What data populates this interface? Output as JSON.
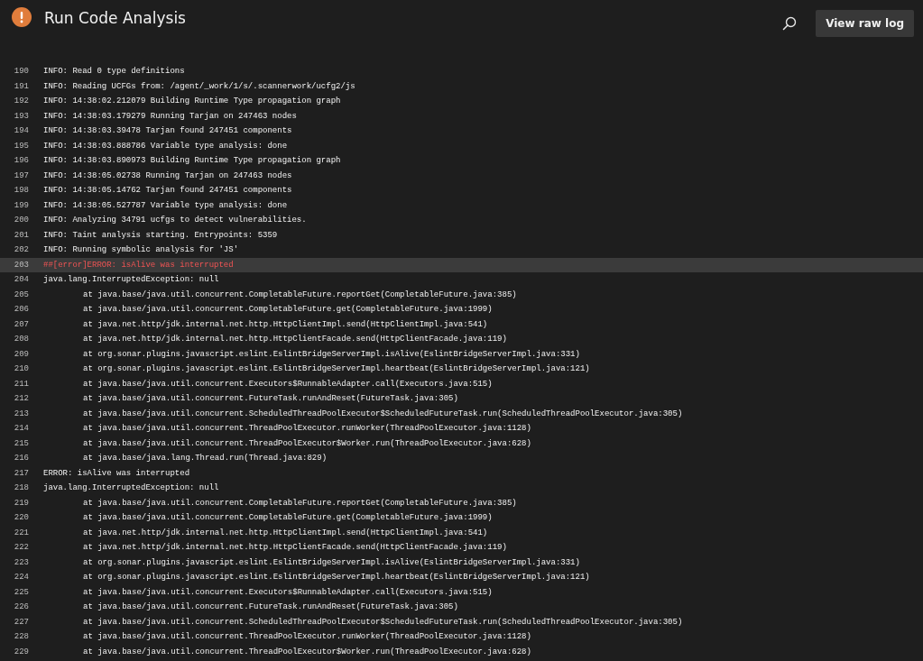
{
  "header": {
    "title": "Run Code Analysis",
    "button": "View raw log"
  },
  "log": [
    {
      "number": "190",
      "text": "INFO: Read 0 type definitions",
      "kind": "info",
      "indented": false,
      "selected": false
    },
    {
      "number": "191",
      "text": "INFO: Reading UCFGs from: /agent/_work/1/s/.scannerwork/ucfg2/js",
      "kind": "info",
      "indented": false,
      "selected": false
    },
    {
      "number": "192",
      "text": "INFO: 14:38:02.212079 Building Runtime Type propagation graph",
      "kind": "info",
      "indented": false,
      "selected": false
    },
    {
      "number": "193",
      "text": "INFO: 14:38:03.179279 Running Tarjan on 247463 nodes",
      "kind": "info",
      "indented": false,
      "selected": false
    },
    {
      "number": "194",
      "text": "INFO: 14:38:03.39478 Tarjan found 247451 components",
      "kind": "info",
      "indented": false,
      "selected": false
    },
    {
      "number": "195",
      "text": "INFO: 14:38:03.888786 Variable type analysis: done",
      "kind": "info",
      "indented": false,
      "selected": false
    },
    {
      "number": "196",
      "text": "INFO: 14:38:03.890973 Building Runtime Type propagation graph",
      "kind": "info",
      "indented": false,
      "selected": false
    },
    {
      "number": "197",
      "text": "INFO: 14:38:05.02738 Running Tarjan on 247463 nodes",
      "kind": "info",
      "indented": false,
      "selected": false
    },
    {
      "number": "198",
      "text": "INFO: 14:38:05.14762 Tarjan found 247451 components",
      "kind": "info",
      "indented": false,
      "selected": false
    },
    {
      "number": "199",
      "text": "INFO: 14:38:05.527787 Variable type analysis: done",
      "kind": "info",
      "indented": false,
      "selected": false
    },
    {
      "number": "200",
      "text": "INFO: Analyzing 34791 ucfgs to detect vulnerabilities.",
      "kind": "info",
      "indented": false,
      "selected": false
    },
    {
      "number": "201",
      "text": "INFO: Taint analysis starting. Entrypoints: 5359",
      "kind": "info",
      "indented": false,
      "selected": false
    },
    {
      "number": "202",
      "text": "INFO: Running symbolic analysis for 'JS'",
      "kind": "info",
      "indented": false,
      "selected": false
    },
    {
      "number": "203",
      "text": "##[error]ERROR: isAlive was interrupted",
      "kind": "error",
      "indented": false,
      "selected": true
    },
    {
      "number": "204",
      "text": "java.lang.InterruptedException: null",
      "kind": "info",
      "indented": false,
      "selected": false
    },
    {
      "number": "205",
      "text": "at java.base/java.util.concurrent.CompletableFuture.reportGet(CompletableFuture.java:385)",
      "kind": "info",
      "indented": true,
      "selected": false
    },
    {
      "number": "206",
      "text": "at java.base/java.util.concurrent.CompletableFuture.get(CompletableFuture.java:1999)",
      "kind": "info",
      "indented": true,
      "selected": false
    },
    {
      "number": "207",
      "text": "at java.net.http/jdk.internal.net.http.HttpClientImpl.send(HttpClientImpl.java:541)",
      "kind": "info",
      "indented": true,
      "selected": false
    },
    {
      "number": "208",
      "text": "at java.net.http/jdk.internal.net.http.HttpClientFacade.send(HttpClientFacade.java:119)",
      "kind": "info",
      "indented": true,
      "selected": false
    },
    {
      "number": "209",
      "text": "at org.sonar.plugins.javascript.eslint.EslintBridgeServerImpl.isAlive(EslintBridgeServerImpl.java:331)",
      "kind": "info",
      "indented": true,
      "selected": false
    },
    {
      "number": "210",
      "text": "at org.sonar.plugins.javascript.eslint.EslintBridgeServerImpl.heartbeat(EslintBridgeServerImpl.java:121)",
      "kind": "info",
      "indented": true,
      "selected": false
    },
    {
      "number": "211",
      "text": "at java.base/java.util.concurrent.Executors$RunnableAdapter.call(Executors.java:515)",
      "kind": "info",
      "indented": true,
      "selected": false
    },
    {
      "number": "212",
      "text": "at java.base/java.util.concurrent.FutureTask.runAndReset(FutureTask.java:305)",
      "kind": "info",
      "indented": true,
      "selected": false
    },
    {
      "number": "213",
      "text": "at java.base/java.util.concurrent.ScheduledThreadPoolExecutor$ScheduledFutureTask.run(ScheduledThreadPoolExecutor.java:305)",
      "kind": "info",
      "indented": true,
      "selected": false
    },
    {
      "number": "214",
      "text": "at java.base/java.util.concurrent.ThreadPoolExecutor.runWorker(ThreadPoolExecutor.java:1128)",
      "kind": "info",
      "indented": true,
      "selected": false
    },
    {
      "number": "215",
      "text": "at java.base/java.util.concurrent.ThreadPoolExecutor$Worker.run(ThreadPoolExecutor.java:628)",
      "kind": "info",
      "indented": true,
      "selected": false
    },
    {
      "number": "216",
      "text": "at java.base/java.lang.Thread.run(Thread.java:829)",
      "kind": "info",
      "indented": true,
      "selected": false
    },
    {
      "number": "217",
      "text": "ERROR: isAlive was interrupted",
      "kind": "info",
      "indented": false,
      "selected": false
    },
    {
      "number": "218",
      "text": "java.lang.InterruptedException: null",
      "kind": "info",
      "indented": false,
      "selected": false
    },
    {
      "number": "219",
      "text": "at java.base/java.util.concurrent.CompletableFuture.reportGet(CompletableFuture.java:385)",
      "kind": "info",
      "indented": true,
      "selected": false
    },
    {
      "number": "220",
      "text": "at java.base/java.util.concurrent.CompletableFuture.get(CompletableFuture.java:1999)",
      "kind": "info",
      "indented": true,
      "selected": false
    },
    {
      "number": "221",
      "text": "at java.net.http/jdk.internal.net.http.HttpClientImpl.send(HttpClientImpl.java:541)",
      "kind": "info",
      "indented": true,
      "selected": false
    },
    {
      "number": "222",
      "text": "at java.net.http/jdk.internal.net.http.HttpClientFacade.send(HttpClientFacade.java:119)",
      "kind": "info",
      "indented": true,
      "selected": false
    },
    {
      "number": "223",
      "text": "at org.sonar.plugins.javascript.eslint.EslintBridgeServerImpl.isAlive(EslintBridgeServerImpl.java:331)",
      "kind": "info",
      "indented": true,
      "selected": false
    },
    {
      "number": "224",
      "text": "at org.sonar.plugins.javascript.eslint.EslintBridgeServerImpl.heartbeat(EslintBridgeServerImpl.java:121)",
      "kind": "info",
      "indented": true,
      "selected": false
    },
    {
      "number": "225",
      "text": "at java.base/java.util.concurrent.Executors$RunnableAdapter.call(Executors.java:515)",
      "kind": "info",
      "indented": true,
      "selected": false
    },
    {
      "number": "226",
      "text": "at java.base/java.util.concurrent.FutureTask.runAndReset(FutureTask.java:305)",
      "kind": "info",
      "indented": true,
      "selected": false
    },
    {
      "number": "227",
      "text": "at java.base/java.util.concurrent.ScheduledThreadPoolExecutor$ScheduledFutureTask.run(ScheduledThreadPoolExecutor.java:305)",
      "kind": "info",
      "indented": true,
      "selected": false
    },
    {
      "number": "228",
      "text": "at java.base/java.util.concurrent.ThreadPoolExecutor.runWorker(ThreadPoolExecutor.java:1128)",
      "kind": "info",
      "indented": true,
      "selected": false
    },
    {
      "number": "229",
      "text": "at java.base/java.util.concurrent.ThreadPoolExecutor$Worker.run(ThreadPoolExecutor.java:628)",
      "kind": "info",
      "indented": true,
      "selected": false
    }
  ]
}
